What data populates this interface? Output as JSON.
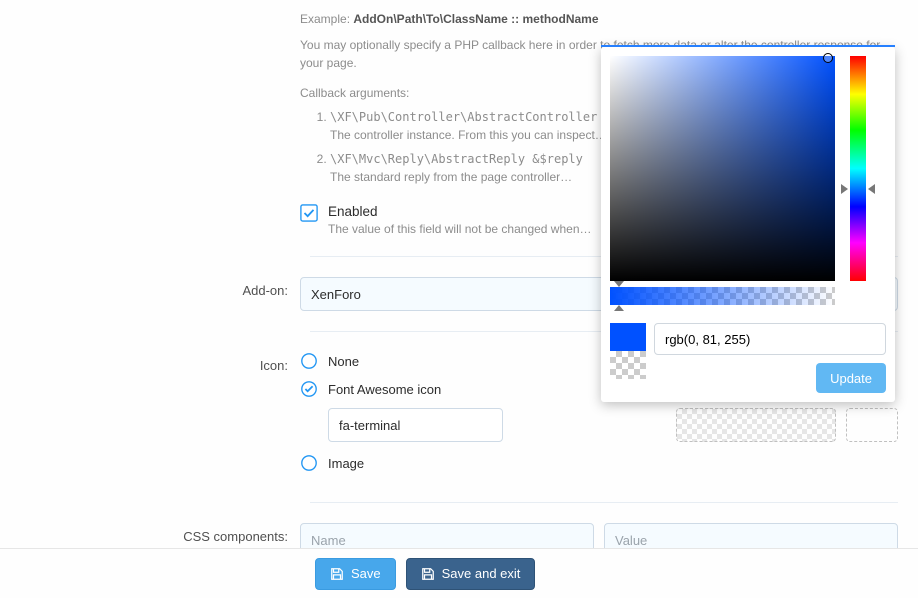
{
  "callback": {
    "example_prefix": "Example: ",
    "example": "AddOn\\Path\\To\\ClassName :: methodName",
    "description": "You may optionally specify a PHP callback here in order to fetch more data or alter the controller response for your page.",
    "args_heading": "Callback arguments:",
    "arg1_code": "\\XF\\Pub\\Controller\\AbstractController",
    "arg1_desc": "The controller instance. From this you can inspect…",
    "arg2_code": "\\XF\\Mvc\\Reply\\AbstractReply &$reply",
    "arg2_desc": "The standard reply from the page controller…"
  },
  "enabled": {
    "label": "Enabled",
    "hint": "The value of this field will not be changed when…",
    "checked": true
  },
  "addon": {
    "label": "Add-on:",
    "value": "XenForo"
  },
  "icon": {
    "label": "Icon:",
    "options": {
      "none": "None",
      "fa": "Font Awesome icon",
      "image": "Image"
    },
    "selected": "fa",
    "fa_value": "fa-terminal"
  },
  "css": {
    "label": "CSS components:",
    "name_placeholder": "Name",
    "value_placeholder": "Value"
  },
  "footer": {
    "save": "Save",
    "save_exit": "Save and exit"
  },
  "picker": {
    "value": "rgb(0, 81, 255)",
    "update": "Update"
  }
}
